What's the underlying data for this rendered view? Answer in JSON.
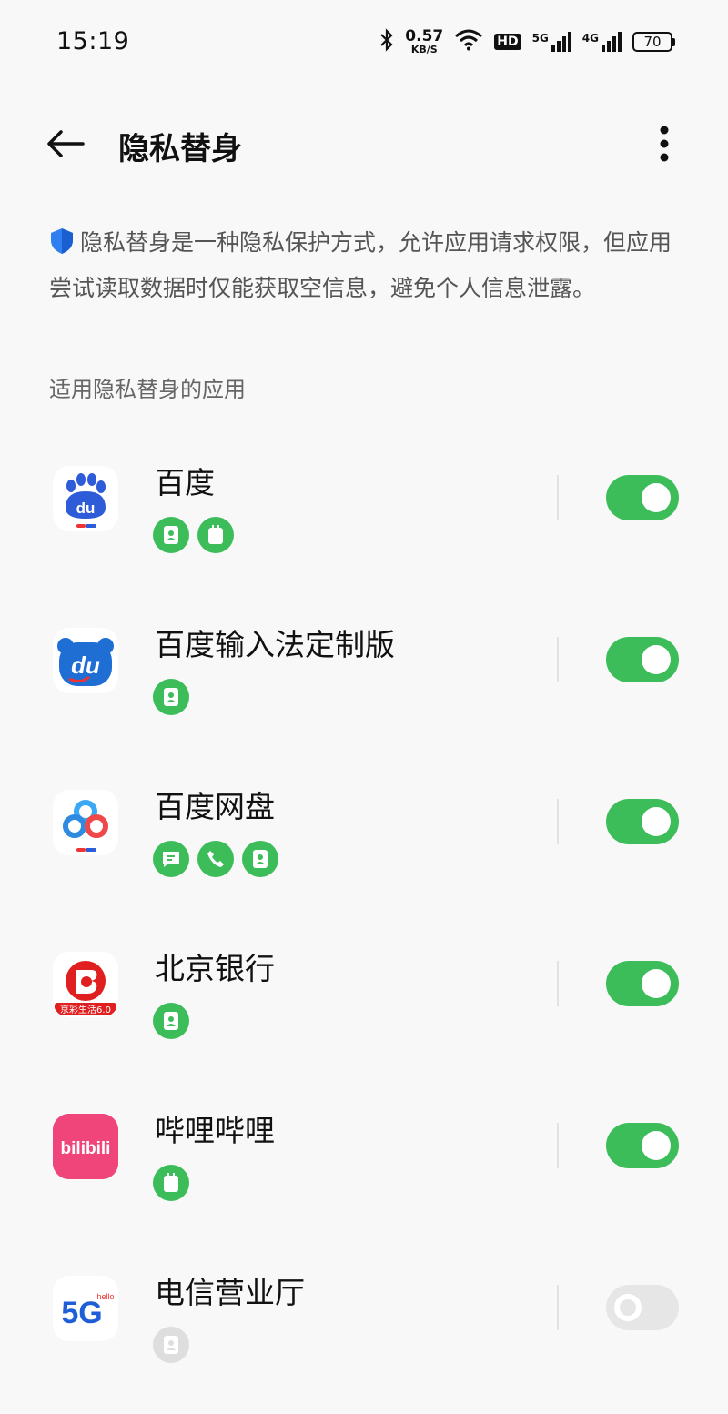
{
  "status_bar": {
    "time": "15:19",
    "net_speed_value": "0.57",
    "net_speed_unit": "KB/S",
    "hd_label": "HD",
    "signal1_label": "5G",
    "signal2_label": "4G",
    "battery": "70"
  },
  "header": {
    "title": "隐私替身"
  },
  "description": "隐私替身是一种隐私保护方式，允许应用请求权限，但应用尝试读取数据时仅能获取空信息，避免个人信息泄露。",
  "section_title": "适用隐私替身的应用",
  "colors": {
    "accent_green": "#3cbd5a",
    "disabled_gray": "#dedede"
  },
  "apps": [
    {
      "name": "百度",
      "perms": [
        "contacts-icon",
        "calendar-icon"
      ],
      "enabled": true
    },
    {
      "name": "百度输入法定制版",
      "perms": [
        "contacts-icon"
      ],
      "enabled": true
    },
    {
      "name": "百度网盘",
      "perms": [
        "message-icon",
        "phone-icon",
        "contacts-icon"
      ],
      "enabled": true
    },
    {
      "name": "北京银行",
      "perms": [
        "contacts-icon"
      ],
      "enabled": true,
      "icon_text": "京彩生活6.0"
    },
    {
      "name": "哔哩哔哩",
      "perms": [
        "calendar-icon"
      ],
      "enabled": true,
      "icon_text": "bilibili"
    },
    {
      "name": "电信营业厅",
      "perms": [
        "contacts-icon"
      ],
      "enabled": false,
      "icon_text": "5G",
      "icon_subtext": "hello"
    }
  ]
}
